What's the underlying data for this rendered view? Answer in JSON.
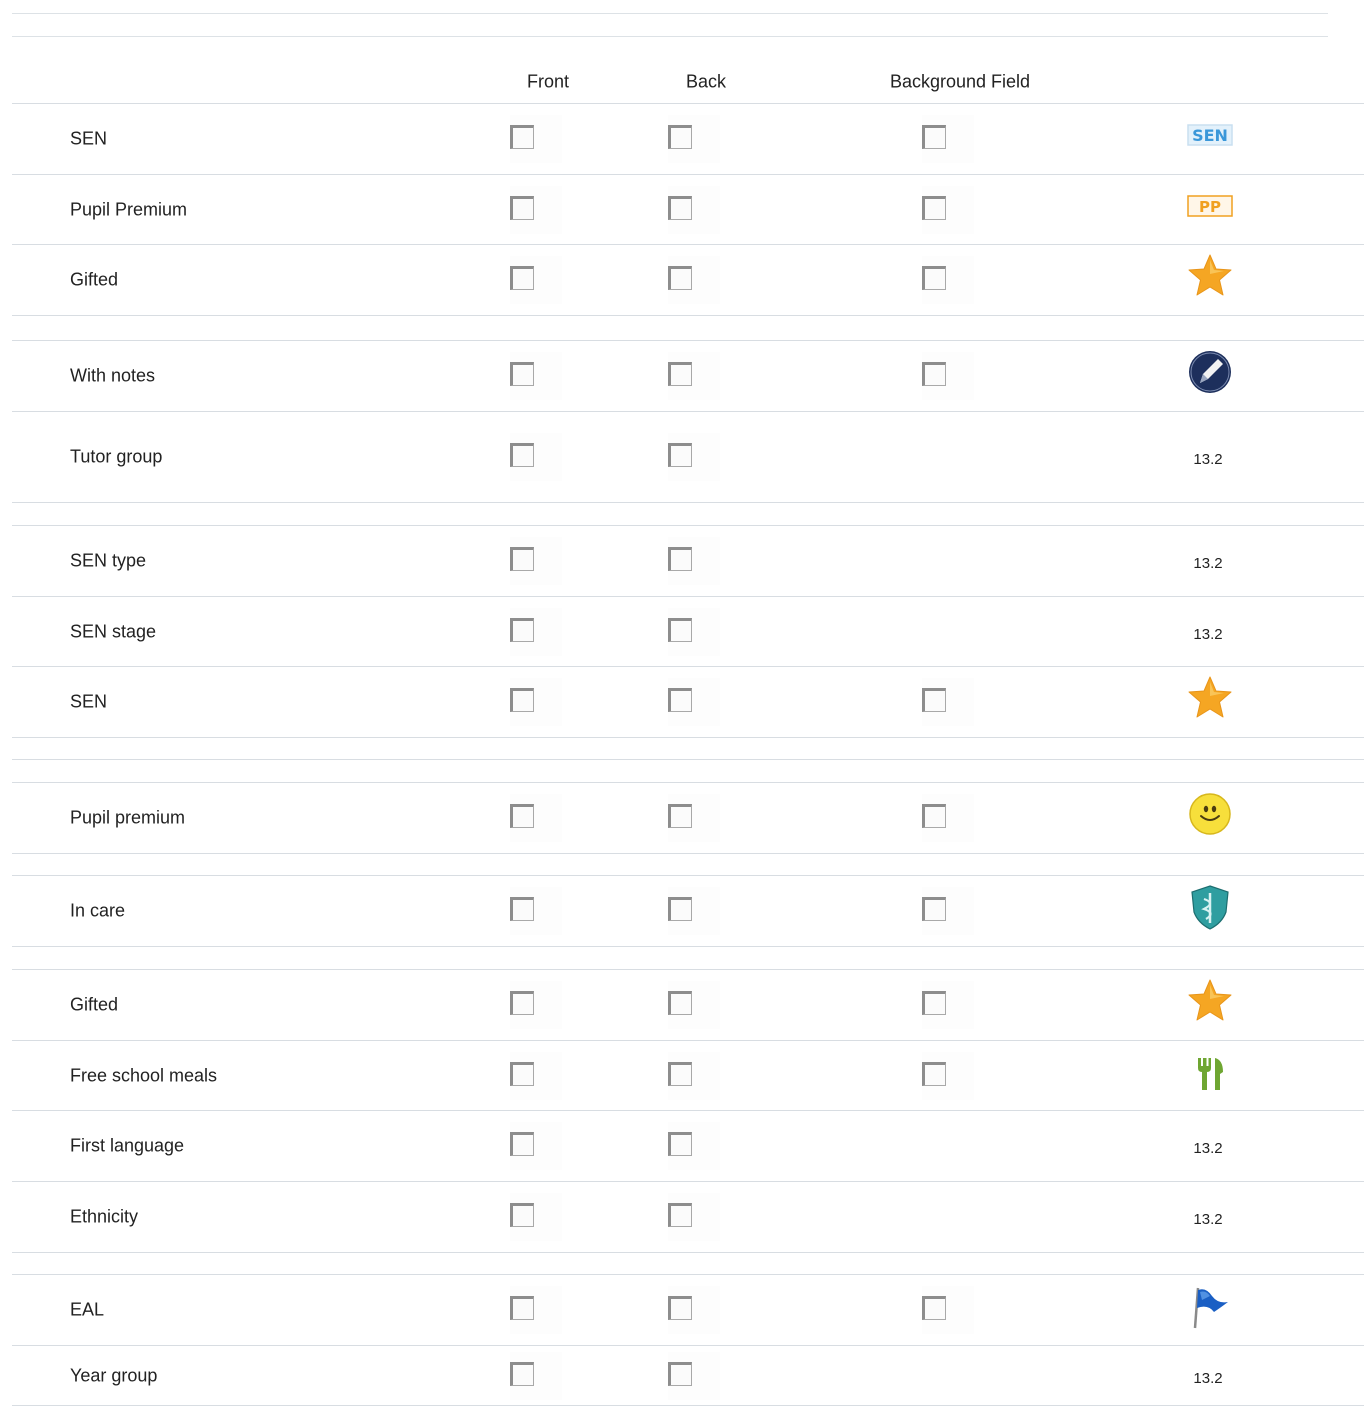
{
  "header": {
    "front": "Front",
    "back": "Back",
    "background_field": "Background Field"
  },
  "rows": [
    {
      "label": "SEN",
      "front": false,
      "back": false,
      "background": false,
      "icon": "sen-badge-icon",
      "icon_text": "SEN",
      "color": "#3a97d9"
    },
    {
      "label": "Pupil Premium",
      "front": false,
      "back": false,
      "background": false,
      "icon": "pp-badge-icon",
      "icon_text": "PP",
      "color": "#f0a020"
    },
    {
      "label": "Gifted",
      "front": false,
      "back": false,
      "background": false,
      "icon": "star-icon",
      "color": "#f5a623"
    },
    {
      "label": "With notes",
      "front": false,
      "back": false,
      "background": false,
      "icon": "notes-pen-icon",
      "color": "#1d2f5c"
    },
    {
      "label": "Tutor group",
      "front": false,
      "back": false,
      "value": "13.2"
    },
    {
      "label": "SEN type",
      "front": false,
      "back": false,
      "value": "13.2"
    },
    {
      "label": "SEN stage",
      "front": false,
      "back": false,
      "value": "13.2"
    },
    {
      "label": "SEN",
      "front": false,
      "back": false,
      "background": false,
      "icon": "star-icon",
      "color": "#f5a623"
    },
    {
      "label": "Pupil premium",
      "front": false,
      "back": false,
      "background": false,
      "icon": "smiley-icon",
      "color": "#f7df3b"
    },
    {
      "label": "In care",
      "front": false,
      "back": false,
      "background": false,
      "icon": "shield-icon",
      "color": "#2f9ea0"
    },
    {
      "label": "Gifted",
      "front": false,
      "back": false,
      "background": false,
      "icon": "star-icon",
      "color": "#f5a623"
    },
    {
      "label": "Free school meals",
      "front": false,
      "back": false,
      "background": false,
      "icon": "cutlery-icon",
      "color": "#6fa632"
    },
    {
      "label": "First language",
      "front": false,
      "back": false,
      "value": "13.2"
    },
    {
      "label": "Ethnicity",
      "front": false,
      "back": false,
      "value": "13.2"
    },
    {
      "label": "EAL",
      "front": false,
      "back": false,
      "background": false,
      "icon": "flag-icon",
      "color": "#1a5fc4"
    },
    {
      "label": "Year group",
      "front": false,
      "back": false,
      "value": "13.2"
    }
  ]
}
